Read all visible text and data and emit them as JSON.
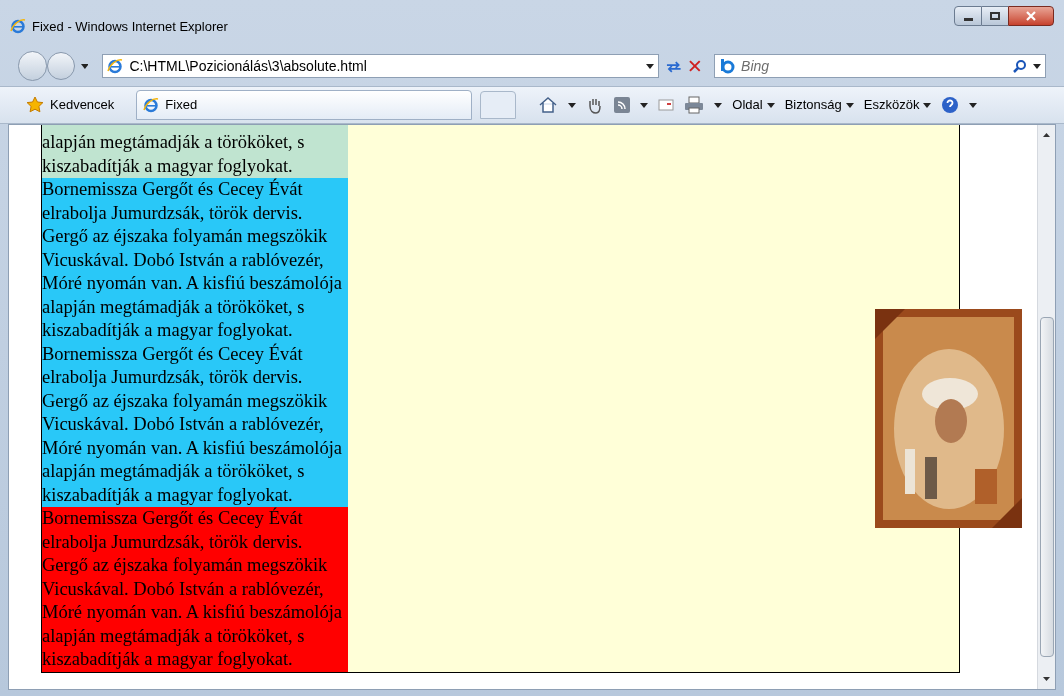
{
  "window": {
    "title": "Fixed - Windows Internet Explorer"
  },
  "address_bar": {
    "url": "C:\\HTML\\Pozicionálás\\3\\absolute.html"
  },
  "search": {
    "placeholder": "Bing"
  },
  "favorites": {
    "label": "Kedvencek"
  },
  "tabs": [
    {
      "label": "Fixed",
      "selected": true
    }
  ],
  "command_bar": [
    {
      "label": "Oldal"
    },
    {
      "label": "Biztonság"
    },
    {
      "label": "Eszközök"
    }
  ],
  "page": {
    "blocks": [
      {
        "color": "#c0e4d0",
        "text": "alapján megtámadják a törököket, s kiszabadítják a magyar foglyokat."
      },
      {
        "color": "#29c8f8",
        "text": "Bornemissza Gergőt és Cecey Évát elrabolja Jumurdzsák, török dervis. Gergő az éjszaka folyamán megszökik Vicuskával. Dobó István a rablóvezér, Móré nyomán van. A kisfiú beszámolója alapján megtámadják a törököket, s kiszabadítják a magyar foglyokat. Bornemissza Gergőt és Cecey Évát elrabolja Jumurdzsák, török dervis. Gergő az éjszaka folyamán megszökik Vicuskával. Dobó István a rablóvezér, Móré nyomán van. A kisfiú beszámolója alapján megtámadják a törököket, s kiszabadítják a magyar foglyokat."
      },
      {
        "color": "#ff0000",
        "text": "Bornemissza Gergőt és Cecey Évát elrabolja Jumurdzsák, török dervis. Gergő az éjszaka folyamán megszökik Vicuskával. Dobó István a rablóvezér, Móré nyomán van. A kisfiú beszámolója alapján megtámadják a törököket, s kiszabadítják a magyar foglyokat."
      }
    ]
  }
}
